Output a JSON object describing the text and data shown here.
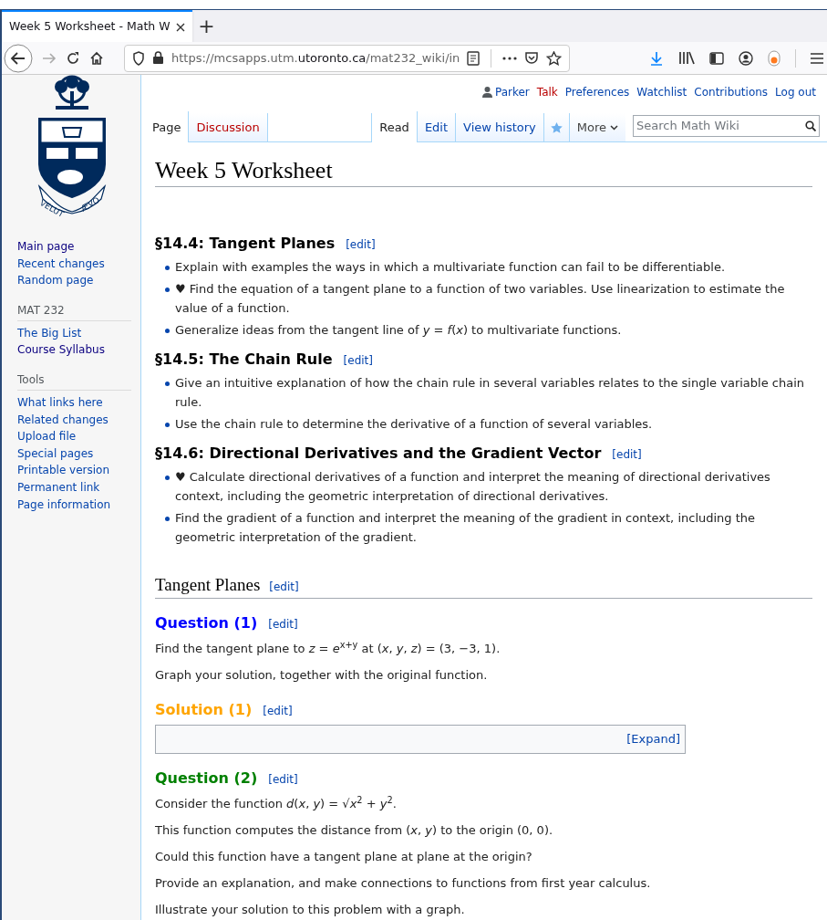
{
  "browser": {
    "tab_title": "Week 5 Worksheet - Math W",
    "new_tab": "+",
    "url": {
      "prefix": "https://mcsapps.utm.",
      "domain": "utoronto.ca",
      "path": "/mat232_wiki/in"
    }
  },
  "logo": {
    "motto_left": "VELUT",
    "motto_right": "ÆVO"
  },
  "personal_links": [
    {
      "label": "Parker",
      "kind": "user",
      "missing": false
    },
    {
      "label": "Talk",
      "kind": "link",
      "missing": true
    },
    {
      "label": "Preferences",
      "kind": "link",
      "missing": false
    },
    {
      "label": "Watchlist",
      "kind": "link",
      "missing": false
    },
    {
      "label": "Contributions",
      "kind": "link",
      "missing": false
    },
    {
      "label": "Log out",
      "kind": "link",
      "missing": false
    }
  ],
  "left_tabs": [
    {
      "label": "Page",
      "selected": true,
      "missing": false
    },
    {
      "label": "Discussion",
      "selected": false,
      "missing": true
    }
  ],
  "right_tabs": [
    {
      "label": "Read",
      "selected": true
    },
    {
      "label": "Edit",
      "selected": false
    },
    {
      "label": "View history",
      "selected": false
    }
  ],
  "more_menu": "More",
  "search": {
    "placeholder": "Search Math Wiki"
  },
  "sidebar": [
    {
      "items": [
        {
          "label": "Main page",
          "visited": true
        },
        {
          "label": "Recent changes",
          "visited": false
        },
        {
          "label": "Random page",
          "visited": false
        }
      ]
    },
    {
      "heading": "MAT 232",
      "items": [
        {
          "label": "The Big List",
          "visited": false
        },
        {
          "label": "Course Syllabus",
          "visited": true
        }
      ]
    },
    {
      "heading": "Tools",
      "items": [
        {
          "label": "What links here",
          "visited": false
        },
        {
          "label": "Related changes",
          "visited": false
        },
        {
          "label": "Upload file",
          "visited": false
        },
        {
          "label": "Special pages",
          "visited": false
        },
        {
          "label": "Printable version",
          "visited": false
        },
        {
          "label": "Permanent link",
          "visited": false
        },
        {
          "label": "Page information",
          "visited": false
        }
      ]
    }
  ],
  "title": "Week 5 Worksheet",
  "content": [
    {
      "kind": "section",
      "text": "§14.4: Tangent Planes",
      "edit": "[edit]"
    },
    {
      "kind": "bullets",
      "items": [
        "Explain with examples the ways in which a multivariate function can fail to be differentiable.",
        "♥ Find the equation of a tangent plane to a function of two variables. Use linearization to estimate the value of a function.",
        "Generalize ideas from the tangent line of *y* = *f*(*x*) to multivariate functions."
      ]
    },
    {
      "kind": "section",
      "text": "§14.5: The Chain Rule",
      "edit": "[edit]"
    },
    {
      "kind": "bullets",
      "items": [
        "Give an intuitive explanation of how the chain rule in several variables relates to the single variable chain rule.",
        "Use the chain rule to determine the derivative of a function of several variables."
      ]
    },
    {
      "kind": "section",
      "text": "§14.6: Directional Derivatives and the Gradient Vector",
      "edit": "[edit]"
    },
    {
      "kind": "bullets",
      "items": [
        "♥ Calculate directional derivatives of a function and interpret the meaning of directional derivatives context, including the geometric interpretation of directional derivatives.",
        "Find the gradient of a function and interpret the meaning of the gradient in context, including the geometric interpretation of the gradient."
      ]
    },
    {
      "kind": "heading",
      "text": "Tangent Planes",
      "edit": "[edit]"
    },
    {
      "kind": "question",
      "text": "Question (1)",
      "edit": "[edit]",
      "color": "#0000ff"
    },
    {
      "kind": "paragraph",
      "text": "Find the tangent plane to *z* = *e*$^{x+y}$ at (*x*, *y*, *z*) = (3, −3, 1)."
    },
    {
      "kind": "paragraph",
      "text": "Graph your solution, together with the original function."
    },
    {
      "kind": "question",
      "text": "Solution (1)",
      "edit": "[edit]",
      "color": "#ffa500"
    },
    {
      "kind": "collapsed",
      "toggle": "[Expand]"
    },
    {
      "kind": "question",
      "text": "Question (2)",
      "edit": "[edit]",
      "color": "#008000"
    },
    {
      "kind": "paragraph",
      "text": "Consider the function *d*(*x*, *y*) = √*x*$^{2}$ + *y*$^{2}$."
    },
    {
      "kind": "paragraph",
      "text": "This function computes the distance from (*x*, *y*) to the origin (0, 0)."
    },
    {
      "kind": "paragraph",
      "text": "Could this function have a tangent plane at plane at the origin?"
    },
    {
      "kind": "paragraph",
      "text": "Provide an explanation, and make connections to functions from first year calculus."
    },
    {
      "kind": "paragraph",
      "text": "Illustrate your solution to this problem with a graph."
    }
  ]
}
